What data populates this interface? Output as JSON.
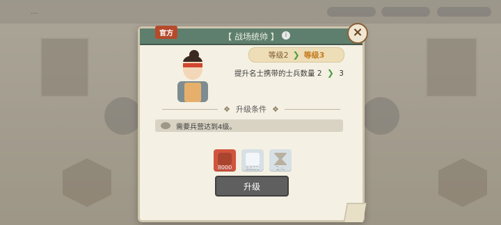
{
  "background": {
    "top_left_title": "…",
    "side_labels": [
      "",
      "",
      "",
      ""
    ]
  },
  "panel": {
    "tag": "官方",
    "title": "【 战场统帅 】",
    "close_icon": "close-icon",
    "info_icon": "info-icon"
  },
  "level": {
    "current": "等级2",
    "next": "等级3"
  },
  "effect": {
    "text": "提升名士携带的士兵数量 2",
    "next_value": "3"
  },
  "section_title": "升级条件",
  "condition": {
    "text": "需要兵营达到4级。"
  },
  "cost_items": [
    {
      "name": "wood",
      "amount": "8000"
    },
    {
      "name": "stone",
      "amount": "8601"
    },
    {
      "name": "hourglass",
      "amount": "2/4"
    }
  ],
  "buttons": {
    "upgrade": "升级"
  },
  "colors": {
    "header": "#5f7f6e",
    "accent_orange": "#c37b1e",
    "positive_green": "#4c9b3e",
    "button_gray": "#5f5f5f"
  }
}
